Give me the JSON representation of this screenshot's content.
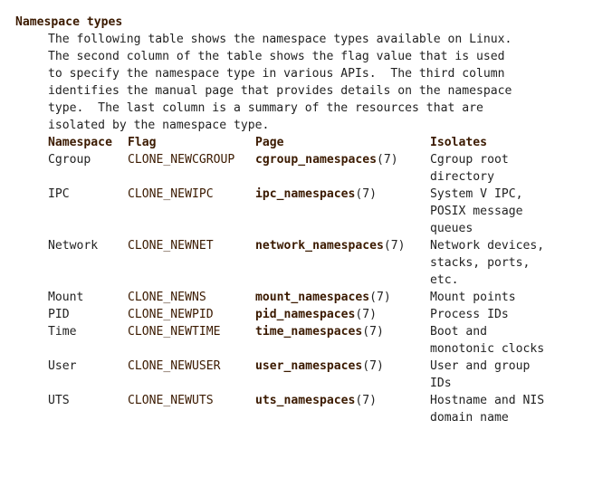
{
  "section": {
    "heading": "Namespace types",
    "paragraph_lines": [
      "The following table shows the namespace types available on Linux.",
      "The second column of the table shows the flag value that is used",
      "to specify the namespace type in various APIs.  The third column",
      "identifies the manual page that provides details on the namespace",
      "type.  The last column is a summary of the resources that are",
      "isolated by the namespace type."
    ]
  },
  "table": {
    "headers": {
      "namespace": "Namespace",
      "flag": "Flag",
      "page": "Page",
      "isolates": "Isolates"
    },
    "rows": [
      {
        "namespace": "Cgroup",
        "flag": "CLONE_NEWCGROUP",
        "page": "cgroup_namespaces",
        "section": "(7)",
        "isolates": "Cgroup root directory"
      },
      {
        "namespace": "IPC",
        "flag": "CLONE_NEWIPC",
        "page": "ipc_namespaces",
        "section": "(7)",
        "isolates": "System V IPC, POSIX message queues"
      },
      {
        "namespace": "Network",
        "flag": "CLONE_NEWNET",
        "page": "network_namespaces",
        "section": "(7)",
        "isolates": "Network devices, stacks, ports, etc."
      },
      {
        "namespace": "Mount",
        "flag": "CLONE_NEWNS",
        "page": "mount_namespaces",
        "section": "(7)",
        "isolates": "Mount points"
      },
      {
        "namespace": "PID",
        "flag": "CLONE_NEWPID",
        "page": "pid_namespaces",
        "section": "(7)",
        "isolates": "Process IDs"
      },
      {
        "namespace": "Time",
        "flag": "CLONE_NEWTIME",
        "page": "time_namespaces",
        "section": "(7)",
        "isolates": "Boot and monotonic clocks"
      },
      {
        "namespace": "User",
        "flag": "CLONE_NEWUSER",
        "page": "user_namespaces",
        "section": "(7)",
        "isolates": "User and group IDs"
      },
      {
        "namespace": "UTS",
        "flag": "CLONE_NEWUTS",
        "page": "uts_namespaces",
        "section": "(7)",
        "isolates": "Hostname and NIS domain name"
      }
    ]
  },
  "colors": {
    "bold_text": "#3b1a00",
    "body_text": "#222222",
    "background": "#ffffff"
  }
}
